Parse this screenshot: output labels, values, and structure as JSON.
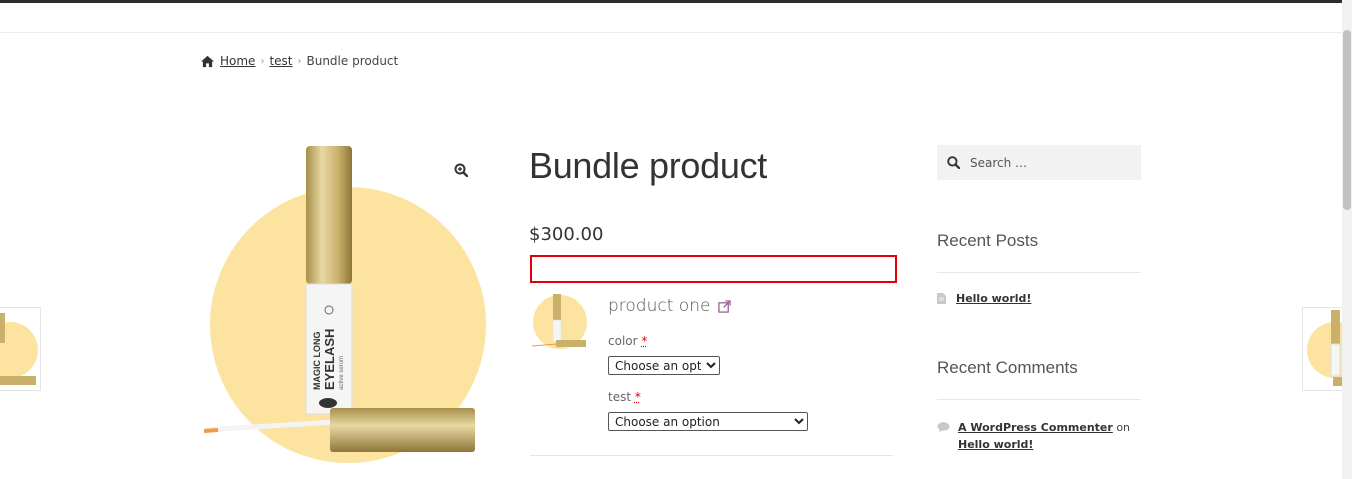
{
  "breadcrumb": {
    "home": "Home",
    "category": "test",
    "current": "Bundle product"
  },
  "product": {
    "title": "Bundle product",
    "price": "$300.00",
    "image_icon": "eyelash-serum-product-image",
    "zoom_icon": "zoom-in-icon"
  },
  "bundle_item": {
    "name": "product one",
    "link_icon": "external-link-icon",
    "fields": [
      {
        "label": "color",
        "required_mark": "*",
        "selected": "Choose an option"
      },
      {
        "label": "test",
        "required_mark": "*",
        "selected": "Choose an option"
      }
    ]
  },
  "sidebar": {
    "search_placeholder": "Search …",
    "recent_posts_title": "Recent Posts",
    "recent_posts": [
      "Hello world!"
    ],
    "recent_comments_title": "Recent Comments",
    "recent_comments": [
      {
        "author": "A WordPress Commenter",
        "connector": "on",
        "post": "Hello world!"
      }
    ]
  },
  "colors": {
    "accent_red": "#e3000b",
    "circle": "#fde3a0",
    "gold": "#c9b06b",
    "link_icon": "#96588a"
  }
}
